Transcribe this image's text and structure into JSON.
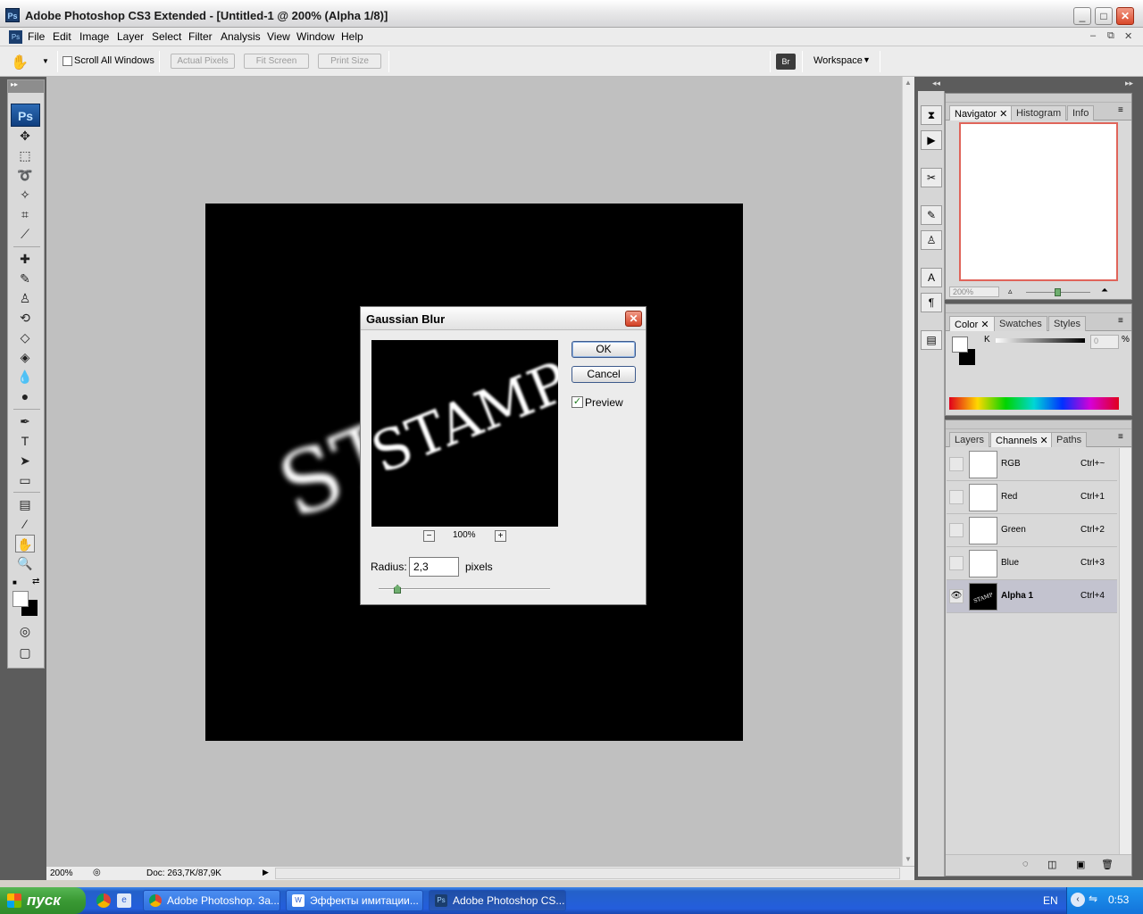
{
  "window": {
    "title": "Adobe Photoshop CS3 Extended - [Untitled-1 @ 200% (Alpha 1/8)]",
    "app_icon": "Ps"
  },
  "menu": [
    "File",
    "Edit",
    "Image",
    "Layer",
    "Select",
    "Filter",
    "Analysis",
    "View",
    "Window",
    "Help"
  ],
  "options": {
    "scroll_all_windows": "Scroll All Windows",
    "actual_pixels": "Actual Pixels",
    "fit_screen": "Fit Screen",
    "print_size": "Print Size",
    "workspace": "Workspace"
  },
  "toolbox": {
    "badge": "Ps"
  },
  "canvas": {
    "stamp_text": "STAMP"
  },
  "dialog": {
    "title": "Gaussian Blur",
    "ok": "OK",
    "cancel": "Cancel",
    "preview_label": "Preview",
    "preview_checked": true,
    "zoom": "100%",
    "radius_label": "Radius:",
    "radius_value": "2,3",
    "radius_unit": "pixels",
    "radius_slider_fraction": 0.11
  },
  "status": {
    "zoom": "200%",
    "doc": "Doc: 263,7K/87,9K"
  },
  "navigator": {
    "tabs": [
      "Navigator",
      "Histogram",
      "Info"
    ],
    "zoom": "200%",
    "zoom_slider_fraction": 0.48,
    "frame_color": "#e0645a"
  },
  "color_panel": {
    "tabs": [
      "Color",
      "Swatches",
      "Styles"
    ],
    "channel_label": "K",
    "value": "0",
    "unit": "%"
  },
  "channels_panel": {
    "tabs": [
      "Layers",
      "Channels",
      "Paths"
    ],
    "rows": [
      {
        "name": "RGB",
        "shortcut": "Ctrl+~",
        "visible": false,
        "active": false
      },
      {
        "name": "Red",
        "shortcut": "Ctrl+1",
        "visible": false,
        "active": false
      },
      {
        "name": "Green",
        "shortcut": "Ctrl+2",
        "visible": false,
        "active": false
      },
      {
        "name": "Blue",
        "shortcut": "Ctrl+3",
        "visible": false,
        "active": false
      },
      {
        "name": "Alpha 1",
        "shortcut": "Ctrl+4",
        "visible": true,
        "active": true
      }
    ],
    "alpha_thumb_text": "STAMP"
  },
  "taskbar": {
    "start": "пуск",
    "tasks": [
      {
        "label": "Adobe Photoshop. За...",
        "active": false
      },
      {
        "label": "Эффекты имитации...",
        "active": false
      },
      {
        "label": "Adobe Photoshop CS...",
        "active": true
      }
    ],
    "lang": "EN",
    "time": "0:53"
  },
  "colors": {
    "workspace_bg": "#c0c0c0",
    "canvas_bg": "#000000",
    "taskbar_blue": "#245edc",
    "active_channel": "#c3c3cf"
  }
}
